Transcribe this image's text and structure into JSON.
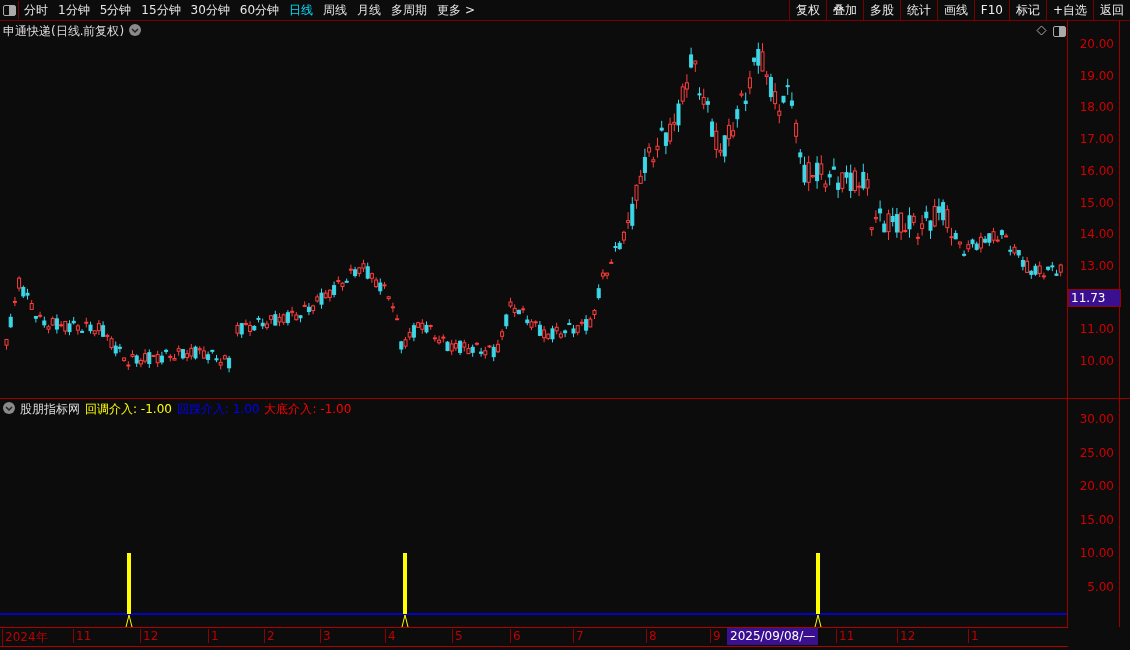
{
  "toolbar": {
    "periods": [
      {
        "label": "分时",
        "selected": false
      },
      {
        "label": "1分钟",
        "selected": false
      },
      {
        "label": "5分钟",
        "selected": false
      },
      {
        "label": "15分钟",
        "selected": false
      },
      {
        "label": "30分钟",
        "selected": false
      },
      {
        "label": "60分钟",
        "selected": false
      },
      {
        "label": "日线",
        "selected": true
      },
      {
        "label": "周线",
        "selected": false
      },
      {
        "label": "月线",
        "selected": false
      },
      {
        "label": "多周期",
        "selected": false
      },
      {
        "label": "更多 >",
        "selected": false
      }
    ],
    "buttons": [
      "复权",
      "叠加",
      "多股",
      "统计",
      "画线",
      "F10",
      "标记",
      "+自选",
      "返回"
    ]
  },
  "main_chart": {
    "title": "申通快递(日线.前复权)",
    "price_ticks": [
      "20.00",
      "19.00",
      "18.00",
      "17.00",
      "16.00",
      "15.00",
      "14.00",
      "13.00",
      "11.00",
      "10.00"
    ],
    "current_price": "11.73"
  },
  "indicator": {
    "name": "股朋指标网",
    "legend": [
      {
        "text": "回调介入: -1.00",
        "color": "#ffff00"
      },
      {
        "text": "回踩介入: 1.00",
        "color": "#0000ff"
      },
      {
        "text": "大底介入: -1.00",
        "color": "#ff0000"
      }
    ],
    "ticks": [
      "30.00",
      "25.00",
      "20.00",
      "15.00",
      "10.00",
      "5.00"
    ]
  },
  "date_axis": {
    "labels": [
      "2024年",
      "11",
      "12",
      "1",
      "2",
      "3",
      "4",
      "5",
      "6",
      "7",
      "8",
      "9",
      "11",
      "12",
      "1"
    ],
    "cursor_date": "2025/09/08/—"
  }
}
